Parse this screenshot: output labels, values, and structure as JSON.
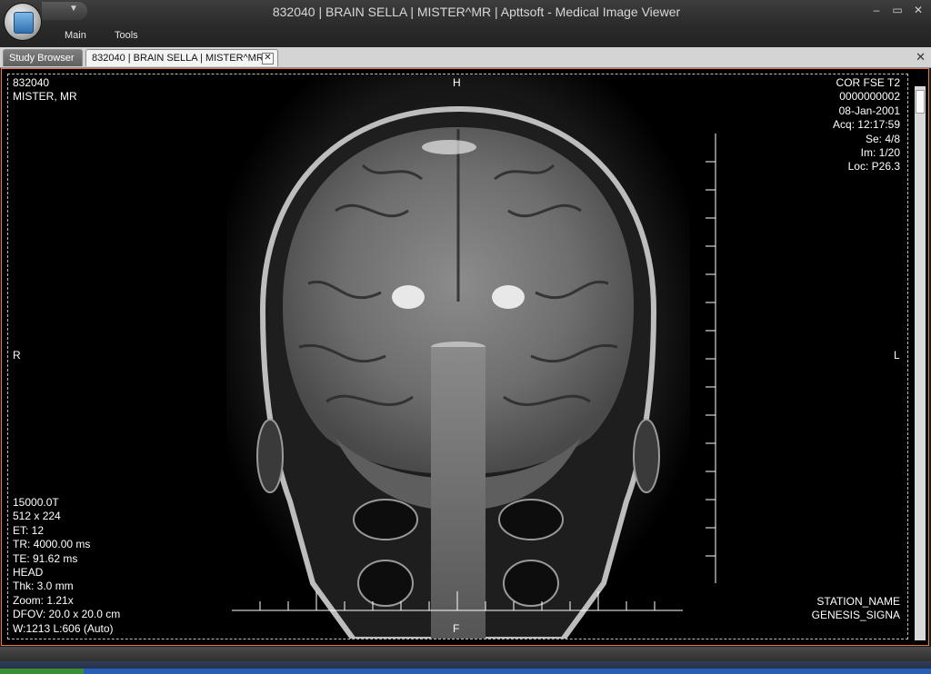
{
  "window": {
    "title": "832040 | BRAIN SELLA | MISTER^MR | Apttsoft - Medical Image Viewer",
    "minimize_label": "–",
    "restore_label": "▭",
    "close_label": "✕"
  },
  "ribbon": {
    "tabs": [
      "Main",
      "Tools"
    ]
  },
  "tabs": {
    "study_browser": "Study Browser",
    "viewer_tab": "832040 | BRAIN SELLA | MISTER^MR",
    "close_glyph": "✕"
  },
  "overlay": {
    "top_left": [
      "832040",
      "MISTER, MR"
    ],
    "top_right": [
      "COR FSE T2",
      "0000000002",
      "08-Jan-2001",
      "Acq: 12:17:59",
      "Se: 4/8",
      "Im: 1/20",
      "Loc: P26.3"
    ],
    "bottom_left": [
      "15000.0T",
      "512 x 224",
      "ET: 12",
      "TR: 4000.00 ms",
      "TE: 91.62 ms",
      "HEAD",
      "Thk: 3.0 mm",
      "Zoom: 1.21x",
      "DFOV: 20.0 x 20.0 cm",
      "W:1213 L:606 (Auto)"
    ],
    "bottom_right": [
      "STATION_NAME",
      "GENESIS_SIGNA"
    ]
  },
  "orientation": {
    "top": "H",
    "bottom": "F",
    "left": "R",
    "right": "L"
  },
  "icons": {
    "app": "app-orb-icon",
    "quick_access": "chevron-down-icon",
    "scroll": "scrollbar"
  },
  "colors": {
    "frame_border": "#e6774a",
    "background": "#000000"
  }
}
